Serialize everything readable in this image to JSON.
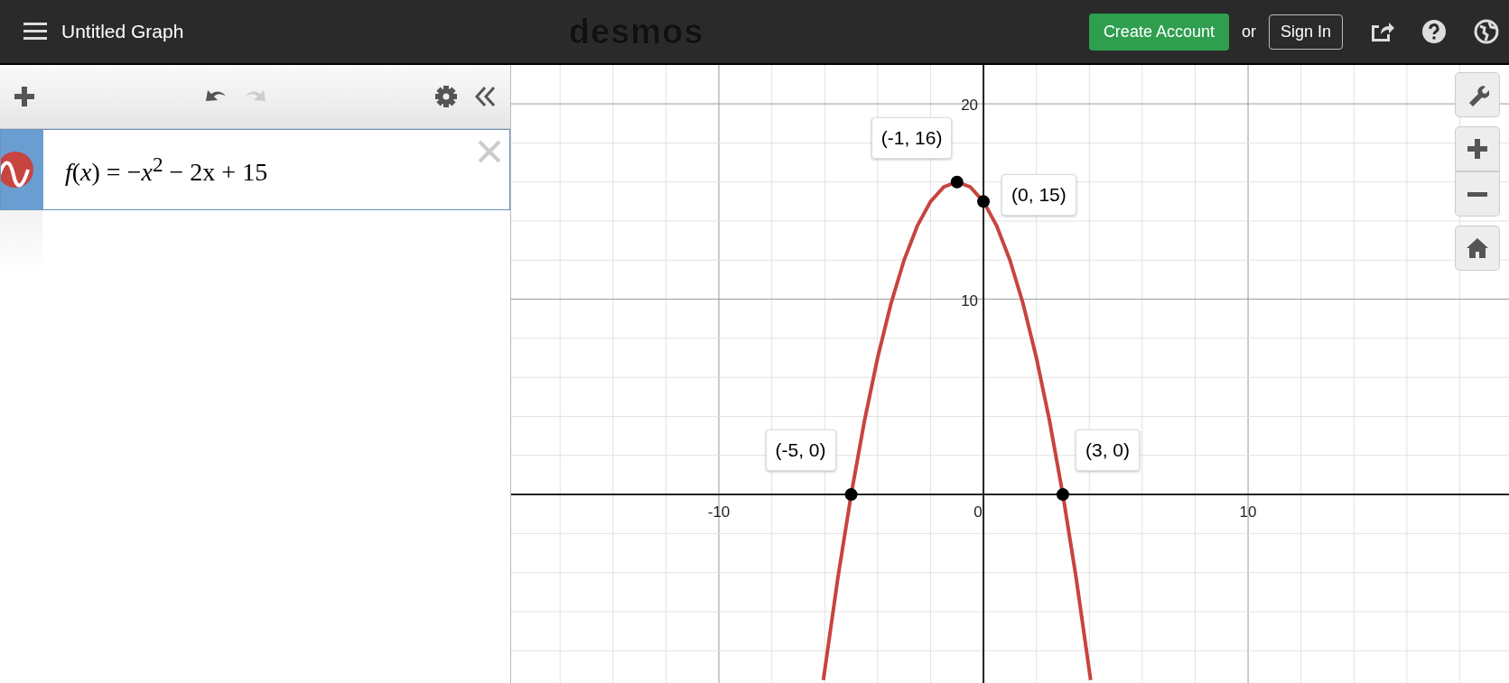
{
  "header": {
    "title": "Untitled Graph",
    "logo": "desmos",
    "create_account": "Create Account",
    "or": "or",
    "sign_in": "Sign In"
  },
  "expressions": [
    {
      "color": "#c74440",
      "latex": "*f*(*x*) = −*x*$^{2}$ − 2x + 15",
      "selected": true
    }
  ],
  "graph": {
    "chart_data": {
      "type": "line",
      "grid": true,
      "xlim": [
        -17.85,
        19.86
      ],
      "ylim": [
        -9.65,
        21.99
      ],
      "xticks": [
        -10,
        0,
        10
      ],
      "yticks": [
        10,
        20
      ],
      "x": [
        -6.05,
        -5.5,
        -5,
        -4.5,
        -4,
        -3.5,
        -3,
        -2.5,
        -2,
        -1.5,
        -1,
        -0.5,
        0,
        0.5,
        1,
        1.5,
        2,
        2.5,
        3,
        3.5,
        4.05
      ],
      "series": [
        {
          "color": "#c74440",
          "values": [
            -9.5025,
            -4.25,
            0,
            3.75,
            7,
            9.75,
            12,
            13.75,
            15,
            15.75,
            16,
            15.75,
            15,
            13.75,
            12,
            9.75,
            7,
            3.75,
            0,
            -4.25,
            -9.5025
          ]
        }
      ],
      "annotations": [
        {
          "x": -1,
          "y": 16,
          "text": "(-1, 16)"
        },
        {
          "x": 0,
          "y": 15,
          "text": "(0, 15)"
        },
        {
          "x": -5,
          "y": 0,
          "text": "(-5, 0)"
        },
        {
          "x": 3,
          "y": 0,
          "text": "(3, 0)"
        }
      ]
    }
  }
}
